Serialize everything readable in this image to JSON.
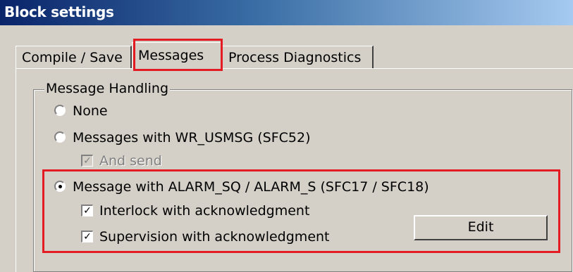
{
  "window": {
    "title": "Block settings"
  },
  "tabs": [
    {
      "label": "Compile / Save",
      "active": false
    },
    {
      "label": "Messages",
      "active": true
    },
    {
      "label": "Process Diagnostics",
      "active": false
    }
  ],
  "message_handling": {
    "group_label": "Message Handling",
    "options": [
      {
        "label": "None",
        "selected": false
      },
      {
        "label": "Messages with WR_USMSG (SFC52)",
        "selected": false
      },
      {
        "label": "Message with ALARM_SQ / ALARM_S (SFC17 / SFC18)",
        "selected": true
      }
    ],
    "and_send": {
      "label": "And send",
      "checked": true,
      "enabled": false
    },
    "interlock": {
      "label": "Interlock with acknowledgment",
      "checked": true
    },
    "supervision": {
      "label": "Supervision with acknowledgment",
      "checked": true
    },
    "edit_button": "Edit"
  },
  "annotation_color": "#e31b23"
}
